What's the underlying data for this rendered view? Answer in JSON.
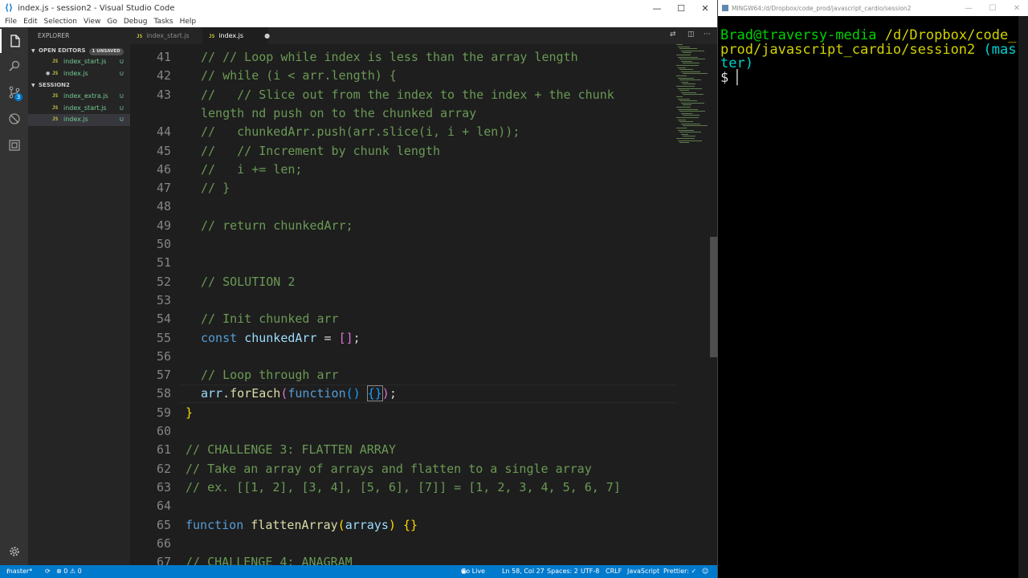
{
  "window": {
    "title": "index.js - session2 - Visual Studio Code",
    "controls": [
      "—",
      "☐",
      "✕"
    ]
  },
  "menu": [
    "File",
    "Edit",
    "Selection",
    "View",
    "Go",
    "Debug",
    "Tasks",
    "Help"
  ],
  "activity": {
    "scm_badge": "3"
  },
  "sidebar": {
    "title": "EXPLORER",
    "open_editors": {
      "label": "OPEN EDITORS",
      "badge": "1 UNSAVED",
      "items": [
        {
          "name": "index_start.js",
          "status": "U",
          "dirty": false
        },
        {
          "name": "index.js",
          "status": "U",
          "dirty": true
        }
      ]
    },
    "folder": {
      "label": "SESSION2",
      "items": [
        {
          "name": "index_extra.js",
          "status": "U"
        },
        {
          "name": "index_start.js",
          "status": "U"
        },
        {
          "name": "index.js",
          "status": "U",
          "selected": true
        }
      ]
    }
  },
  "tabs": [
    {
      "label": "index_start.js",
      "active": false
    },
    {
      "label": "index.js",
      "active": true,
      "modified_dot": "●"
    }
  ],
  "code_lines": [
    {
      "n": "41",
      "tokens": [
        [
          "cm",
          "// // Loop while index is less than the array length"
        ]
      ]
    },
    {
      "n": "42",
      "tokens": [
        [
          "cm",
          "// while (i < arr.length) {"
        ]
      ]
    },
    {
      "n": "43",
      "tokens": [
        [
          "cm",
          "//   // Slice out from the index to the index + the chunk"
        ]
      ]
    },
    {
      "n": "",
      "tokens": [
        [
          "cm",
          "length nd push on to the chunked array"
        ]
      ]
    },
    {
      "n": "44",
      "tokens": [
        [
          "cm",
          "//   chunkedArr.push(arr.slice(i, i + len));"
        ]
      ]
    },
    {
      "n": "45",
      "tokens": [
        [
          "cm",
          "//   // Increment by chunk length"
        ]
      ]
    },
    {
      "n": "46",
      "tokens": [
        [
          "cm",
          "//   i += len;"
        ]
      ]
    },
    {
      "n": "47",
      "tokens": [
        [
          "cm",
          "// }"
        ]
      ]
    },
    {
      "n": "48",
      "tokens": []
    },
    {
      "n": "49",
      "tokens": [
        [
          "cm",
          "// return chunkedArr;"
        ]
      ]
    },
    {
      "n": "50",
      "tokens": []
    },
    {
      "n": "51",
      "tokens": []
    },
    {
      "n": "52",
      "tokens": [
        [
          "cm",
          "// SOLUTION 2"
        ]
      ]
    },
    {
      "n": "53",
      "tokens": []
    },
    {
      "n": "54",
      "tokens": [
        [
          "cm",
          "// Init chunked arr"
        ]
      ]
    },
    {
      "n": "55",
      "tokens": [
        [
          "kw",
          "const "
        ],
        [
          "vr",
          "chunkedArr"
        ],
        [
          "pl",
          " = "
        ],
        [
          "br2",
          "[]"
        ],
        [
          "pl",
          ";"
        ]
      ]
    },
    {
      "n": "56",
      "tokens": []
    },
    {
      "n": "57",
      "tokens": [
        [
          "cm",
          "// Loop through arr"
        ]
      ]
    },
    {
      "n": "58",
      "tokens": [
        [
          "vr",
          "arr"
        ],
        [
          "pl",
          "."
        ],
        [
          "fn",
          "forEach"
        ],
        [
          "br2",
          "("
        ],
        [
          "kw",
          "function"
        ],
        [
          "br3",
          "()"
        ],
        [
          "pl",
          " "
        ],
        [
          "br3",
          "{}"
        ],
        [
          "br2",
          ")"
        ],
        [
          "pl",
          ";"
        ]
      ]
    },
    {
      "n": "59",
      "tokens": [
        [
          "br1",
          "}"
        ]
      ]
    },
    {
      "n": "60",
      "tokens": []
    },
    {
      "n": "61",
      "tokens": [
        [
          "cm",
          "// CHALLENGE 3: FLATTEN ARRAY"
        ]
      ]
    },
    {
      "n": "62",
      "tokens": [
        [
          "cm",
          "// Take an array of arrays and flatten to a single array"
        ]
      ]
    },
    {
      "n": "63",
      "tokens": [
        [
          "cm",
          "// ex. [[1, 2], [3, 4], [5, 6], [7]] = [1, 2, 3, 4, 5, 6, 7]"
        ]
      ]
    },
    {
      "n": "64",
      "tokens": []
    },
    {
      "n": "65",
      "tokens": [
        [
          "kw",
          "function "
        ],
        [
          "fn",
          "flattenArray"
        ],
        [
          "br1",
          "("
        ],
        [
          "vr",
          "arrays"
        ],
        [
          "br1",
          ")"
        ],
        [
          "pl",
          " "
        ],
        [
          "br1",
          "{}"
        ]
      ]
    },
    {
      "n": "66",
      "tokens": []
    },
    {
      "n": "67",
      "tokens": [
        [
          "cm",
          "// CHALLENGE 4: ANAGRAM"
        ]
      ]
    }
  ],
  "status": {
    "branch": "master*",
    "sync": "⟳",
    "problems": "⊗ 0 ⚠ 0",
    "go_live": "Go Live",
    "position": "Ln 58, Col 27",
    "spaces": "Spaces: 2",
    "encoding": "UTF-8",
    "eol": "CRLF",
    "language": "JavaScript",
    "formatter": "Prettier: ✓"
  },
  "terminal": {
    "title": "MINGW64:/d/Dropbox/code_prod/javascript_cardio/session2",
    "user": "Brad@traversy-media",
    "path": "/d/Dropbox/code_prod/javascript_cardio/session2",
    "branch": "(master)",
    "prompt": "$"
  }
}
